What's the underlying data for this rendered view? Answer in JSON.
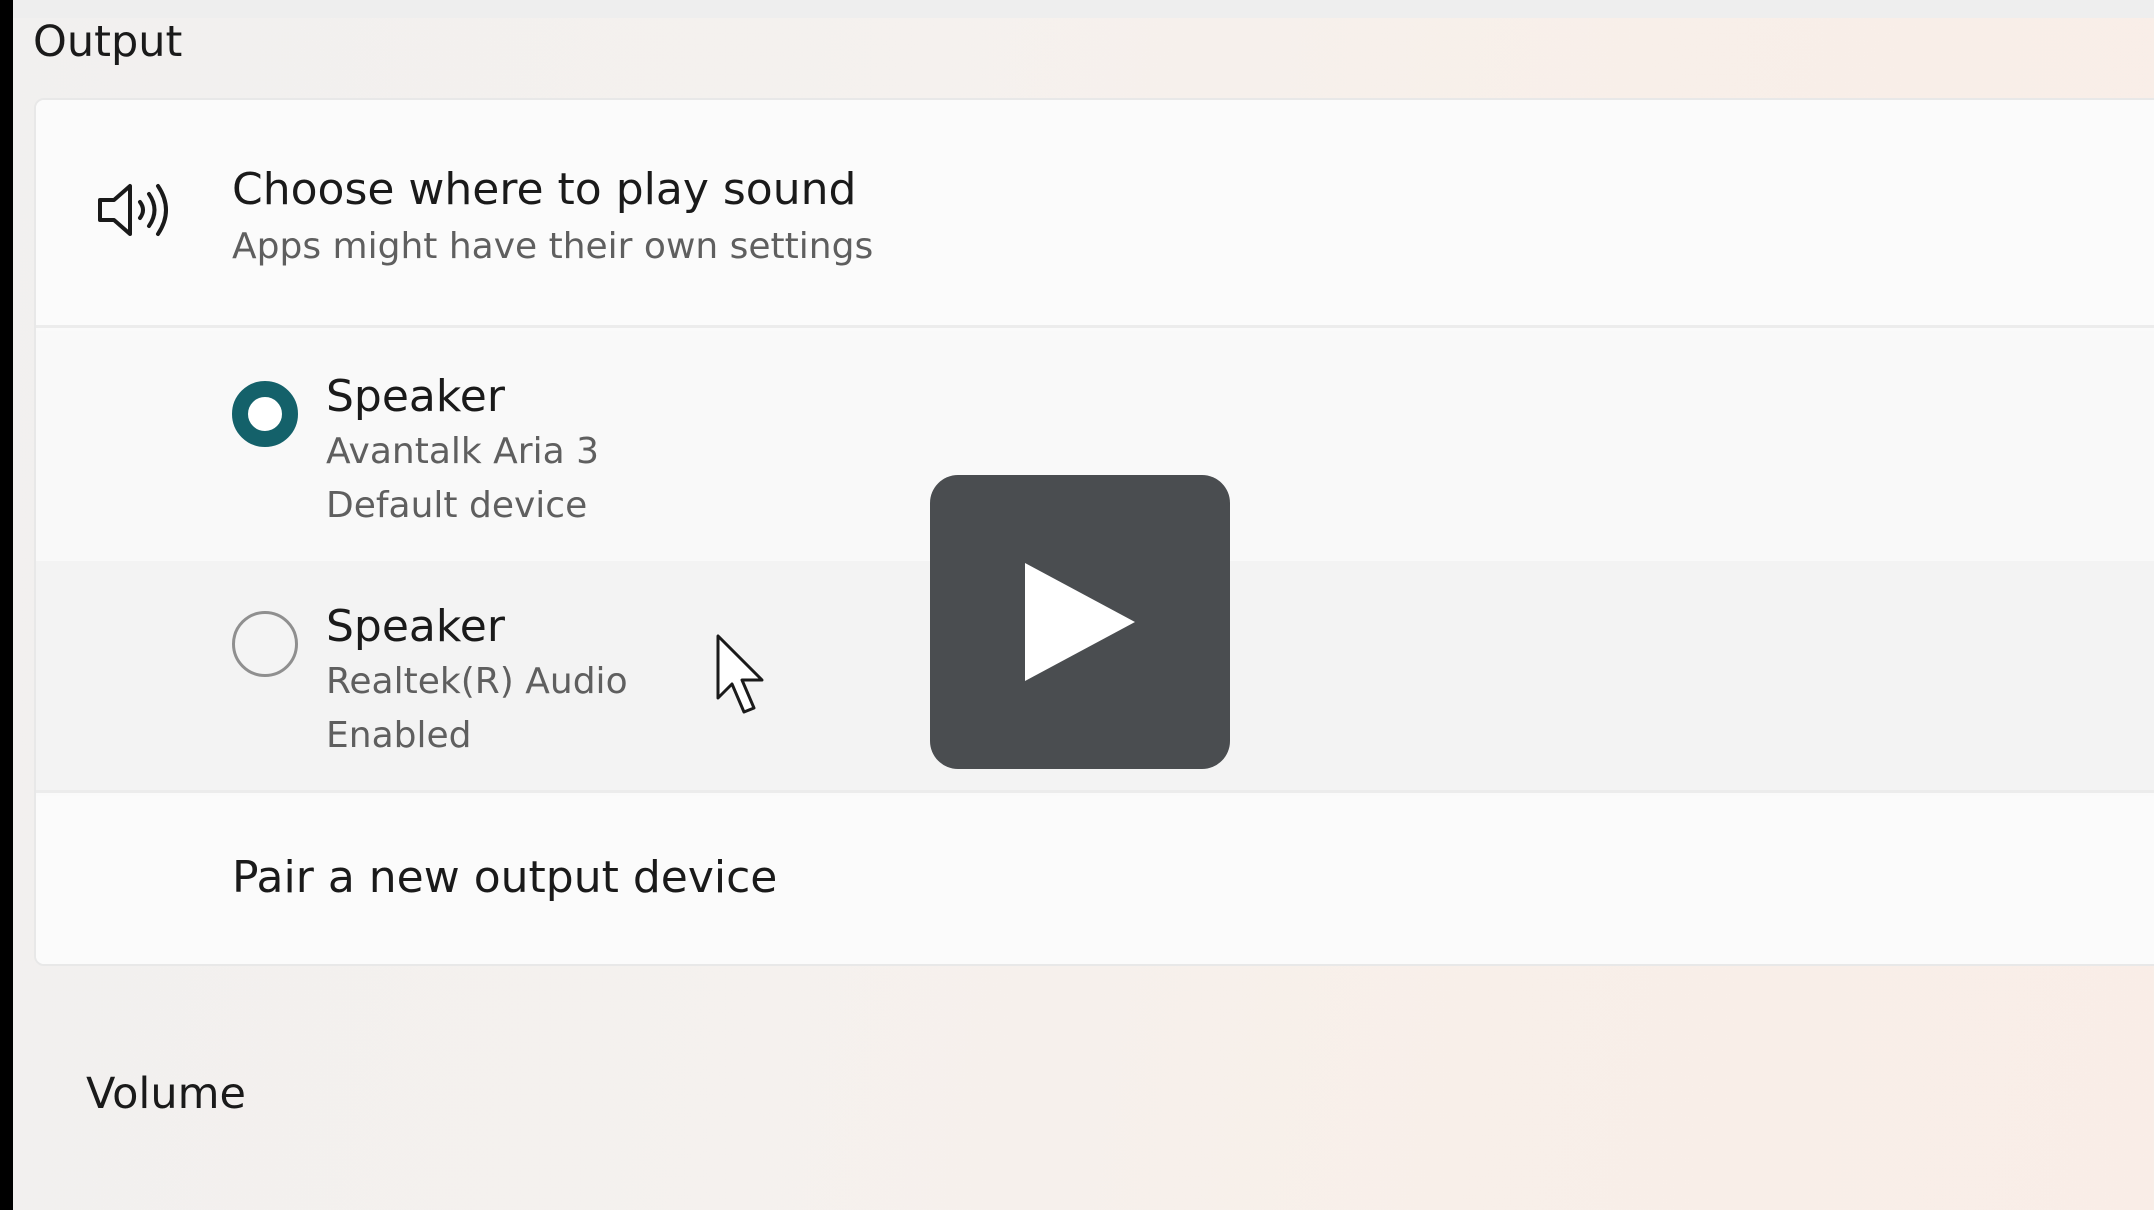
{
  "section": {
    "title": "Output"
  },
  "header": {
    "icon": "speaker-volume-icon",
    "title": "Choose where to play sound",
    "subtitle": "Apps might have their own settings"
  },
  "devices": [
    {
      "name": "Speaker",
      "line1": "Avantalk Aria 3",
      "line2": "Default device",
      "selected": true
    },
    {
      "name": "Speaker",
      "line1": "Realtek(R) Audio",
      "line2": "Enabled",
      "selected": false
    }
  ],
  "pair": {
    "label": "Pair a new output device"
  },
  "volume": {
    "label": "Volume"
  },
  "overlay": {
    "icon": "play-icon"
  },
  "colors": {
    "accent": "#14616a",
    "overlay": "#4a4d50"
  }
}
